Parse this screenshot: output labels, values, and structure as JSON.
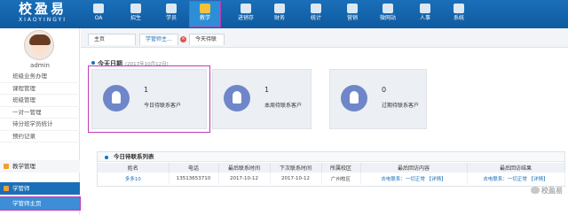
{
  "logo": {
    "title": "校盈易",
    "subtitle": "XIAOYINGYI"
  },
  "nav": [
    {
      "label": "OA",
      "icon": "oa-icon"
    },
    {
      "label": "招生",
      "icon": "enroll-icon"
    },
    {
      "label": "学员",
      "icon": "students-icon"
    },
    {
      "label": "教学",
      "icon": "teaching-icon",
      "active": true
    },
    {
      "label": "进销存",
      "icon": "inventory-icon"
    },
    {
      "label": "财务",
      "icon": "finance-icon"
    },
    {
      "label": "统计",
      "icon": "stats-icon"
    },
    {
      "label": "营销",
      "icon": "marketing-icon"
    },
    {
      "label": "微网站",
      "icon": "microsite-icon"
    },
    {
      "label": "人事",
      "icon": "hr-icon"
    },
    {
      "label": "系统",
      "icon": "system-icon"
    }
  ],
  "sidebar": {
    "username": "admin",
    "items": [
      "班级业务办理",
      "课程管理",
      "班级管理",
      "一对一管理",
      "待分班学员统计",
      "预约记录"
    ],
    "section_teaching": "教学管理",
    "section_advisor": "学管师",
    "active_sub": "学管师主页"
  },
  "tabs": [
    {
      "label": "主页"
    },
    {
      "label": "学管师主..."
    },
    {
      "label": "今天待联"
    }
  ],
  "today": {
    "title": "今天日期",
    "date": "(2017年10月12日)"
  },
  "cards": [
    {
      "value": "1",
      "label": "今日待联系客户"
    },
    {
      "value": "1",
      "label": "本周待联系客户"
    },
    {
      "value": "0",
      "label": "过期待联系客户"
    }
  ],
  "list": {
    "title": "今日待联系列表",
    "columns": [
      "姓名",
      "电话",
      "最后联系时间",
      "下次联系时间",
      "所属校区",
      "最后回访内容",
      "最后回访结果"
    ],
    "rows": [
      [
        "多多10",
        "13513653710",
        "2017-10-12",
        "2017-10-12",
        "广州校区",
        "去电联系：一切正常 【详情】",
        "去电联系：一切正常 【详情】"
      ]
    ]
  },
  "watermark": "校盈易",
  "colors": {
    "topbar": "#1a6fb8",
    "highlight": "#c03ab8",
    "card_icon": "#6f86c9"
  }
}
